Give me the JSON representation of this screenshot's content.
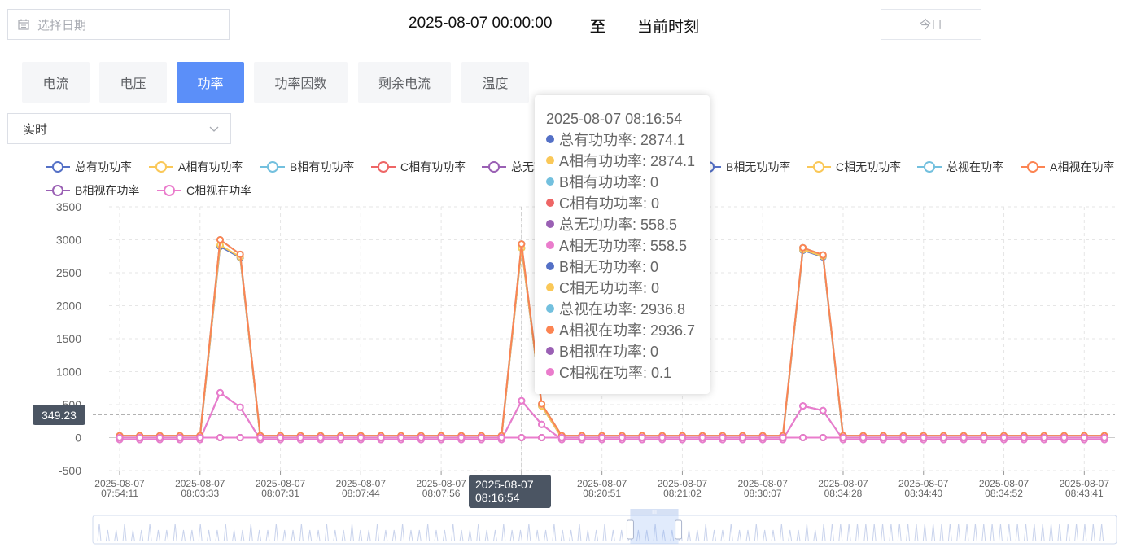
{
  "date_picker": {
    "placeholder": "选择日期"
  },
  "range": {
    "start": "2025-08-07 00:00:00",
    "separator": "至",
    "end": "当前时刻"
  },
  "today_button": "今日",
  "tabs": [
    {
      "label": "电流"
    },
    {
      "label": "电压"
    },
    {
      "label": "功率"
    },
    {
      "label": "功率因数"
    },
    {
      "label": "剩余电流"
    },
    {
      "label": "温度"
    }
  ],
  "active_tab": 2,
  "mode_select": {
    "value": "实时"
  },
  "colors": {
    "total_active": "#5470c6",
    "a_active": "#fac858",
    "b_active": "#73c0de",
    "c_active": "#ee6666",
    "total_reactive": "#9a60b4",
    "a_reactive": "#ea7ccc",
    "b_reactive": "#5470c6",
    "c_reactive": "#fac858",
    "total_apparent": "#73c0de",
    "a_apparent": "#fc8452",
    "b_apparent": "#9a60b4",
    "c_apparent": "#ea7ccc",
    "accent": "#5b8ff9"
  },
  "chart_data": {
    "type": "line",
    "ylim": [
      -500,
      3500
    ],
    "yticks": [
      3500,
      3000,
      2500,
      2000,
      1500,
      1000,
      500,
      0,
      -500
    ],
    "x_tick_labels": [
      {
        "date": "2025-08-07",
        "time": "07:54:11",
        "index": 0
      },
      {
        "date": "2025-08-07",
        "time": "08:03:33",
        "index": 4
      },
      {
        "date": "2025-08-07",
        "time": "08:07:31",
        "index": 8
      },
      {
        "date": "2025-08-07",
        "time": "08:07:44",
        "index": 12
      },
      {
        "date": "2025-08-07",
        "time": "08:07:56",
        "index": 16
      },
      {
        "date": "2025-08-07",
        "time": "08:16:54",
        "index": 20
      },
      {
        "date": "2025-08-07",
        "time": "08:20:51",
        "index": 24
      },
      {
        "date": "2025-08-07",
        "time": "08:21:02",
        "index": 28
      },
      {
        "date": "2025-08-07",
        "time": "08:30:07",
        "index": 32
      },
      {
        "date": "2025-08-07",
        "time": "08:34:28",
        "index": 36
      },
      {
        "date": "2025-08-07",
        "time": "08:34:40",
        "index": 40
      },
      {
        "date": "2025-08-07",
        "time": "08:34:52",
        "index": 44
      },
      {
        "date": "2025-08-07",
        "time": "08:43:41",
        "index": 48
      }
    ],
    "point_count": 50,
    "series": [
      {
        "name": "总有功功率",
        "color": "#5470c6",
        "values": [
          0,
          0,
          0,
          0,
          0,
          2900,
          2730,
          0,
          0,
          0,
          0,
          0,
          0,
          0,
          0,
          0,
          0,
          0,
          0,
          0,
          2874,
          480,
          0,
          0,
          0,
          0,
          0,
          0,
          0,
          0,
          0,
          0,
          0,
          0,
          2840,
          2740,
          0,
          0,
          0,
          0,
          0,
          0,
          0,
          0,
          0,
          0,
          0,
          0,
          0,
          0
        ]
      },
      {
        "name": "A相有功功率",
        "color": "#fac858",
        "values": [
          0,
          0,
          0,
          0,
          0,
          2920,
          2740,
          0,
          0,
          0,
          0,
          0,
          0,
          0,
          0,
          0,
          0,
          0,
          0,
          0,
          2874,
          480,
          0,
          0,
          0,
          0,
          0,
          0,
          0,
          0,
          0,
          0,
          0,
          0,
          2850,
          2750,
          0,
          0,
          0,
          0,
          0,
          0,
          0,
          0,
          0,
          0,
          0,
          0,
          0,
          0
        ]
      },
      {
        "name": "B相有功功率",
        "color": "#73c0de",
        "values": [
          0,
          0,
          0,
          0,
          0,
          0,
          0,
          0,
          0,
          0,
          0,
          0,
          0,
          0,
          0,
          0,
          0,
          0,
          0,
          0,
          0,
          0,
          0,
          0,
          0,
          0,
          0,
          0,
          0,
          0,
          0,
          0,
          0,
          0,
          0,
          0,
          0,
          0,
          0,
          0,
          0,
          0,
          0,
          0,
          0,
          0,
          0,
          0,
          0,
          0
        ]
      },
      {
        "name": "C相有功功率",
        "color": "#ee6666",
        "values": [
          0,
          0,
          0,
          0,
          0,
          0,
          0,
          0,
          0,
          0,
          0,
          0,
          0,
          0,
          0,
          0,
          0,
          0,
          0,
          0,
          0,
          0,
          0,
          0,
          0,
          0,
          0,
          0,
          0,
          0,
          0,
          0,
          0,
          0,
          0,
          0,
          0,
          0,
          0,
          0,
          0,
          0,
          0,
          0,
          0,
          0,
          0,
          0,
          0,
          0
        ]
      },
      {
        "name": "总无功功率",
        "color": "#9a60b4",
        "values": [
          -30,
          -30,
          -30,
          -30,
          -30,
          680,
          460,
          -30,
          -30,
          -30,
          -30,
          -30,
          -30,
          -30,
          -30,
          -30,
          -30,
          -30,
          -30,
          -30,
          558.5,
          200,
          -30,
          -30,
          -30,
          -30,
          -30,
          -30,
          -30,
          -30,
          -30,
          -30,
          -30,
          -30,
          480,
          410,
          -30,
          -30,
          -30,
          -30,
          -30,
          -30,
          -30,
          -30,
          -30,
          -30,
          -30,
          -30,
          -30,
          -30
        ]
      },
      {
        "name": "A相无功功率",
        "color": "#ea7ccc",
        "values": [
          -30,
          -30,
          -30,
          -30,
          -30,
          680,
          460,
          -30,
          -30,
          -30,
          -30,
          -30,
          -30,
          -30,
          -30,
          -30,
          -30,
          -30,
          -30,
          -30,
          558.5,
          200,
          -30,
          -30,
          -30,
          -30,
          -30,
          -30,
          -30,
          -30,
          -30,
          -30,
          -30,
          -30,
          480,
          410,
          -30,
          -30,
          -30,
          -30,
          -30,
          -30,
          -30,
          -30,
          -30,
          -30,
          -30,
          -30,
          -30,
          -30
        ]
      },
      {
        "name": "B相无功功率",
        "color": "#5470c6",
        "values": [
          0,
          0,
          0,
          0,
          0,
          0,
          0,
          0,
          0,
          0,
          0,
          0,
          0,
          0,
          0,
          0,
          0,
          0,
          0,
          0,
          0,
          0,
          0,
          0,
          0,
          0,
          0,
          0,
          0,
          0,
          0,
          0,
          0,
          0,
          0,
          0,
          0,
          0,
          0,
          0,
          0,
          0,
          0,
          0,
          0,
          0,
          0,
          0,
          0,
          0
        ]
      },
      {
        "name": "C相无功功率",
        "color": "#fac858",
        "values": [
          0,
          0,
          0,
          0,
          0,
          0,
          0,
          0,
          0,
          0,
          0,
          0,
          0,
          0,
          0,
          0,
          0,
          0,
          0,
          0,
          0,
          0,
          0,
          0,
          0,
          0,
          0,
          0,
          0,
          0,
          0,
          0,
          0,
          0,
          0,
          0,
          0,
          0,
          0,
          0,
          0,
          0,
          0,
          0,
          0,
          0,
          0,
          0,
          0,
          0
        ]
      },
      {
        "name": "总视在功率",
        "color": "#73c0de",
        "values": [
          30,
          30,
          30,
          30,
          30,
          3000,
          2780,
          30,
          30,
          30,
          30,
          30,
          30,
          30,
          30,
          30,
          30,
          30,
          30,
          30,
          2936.8,
          510,
          30,
          30,
          30,
          30,
          30,
          30,
          30,
          30,
          30,
          30,
          30,
          30,
          2880,
          2770,
          30,
          30,
          30,
          30,
          30,
          30,
          30,
          30,
          30,
          30,
          30,
          30,
          30,
          30
        ]
      },
      {
        "name": "A相视在功率",
        "color": "#fc8452",
        "values": [
          30,
          30,
          30,
          30,
          30,
          3000,
          2780,
          30,
          30,
          30,
          30,
          30,
          30,
          30,
          30,
          30,
          30,
          30,
          30,
          30,
          2936.7,
          510,
          30,
          30,
          30,
          30,
          30,
          30,
          30,
          30,
          30,
          30,
          30,
          30,
          2880,
          2770,
          30,
          30,
          30,
          30,
          30,
          30,
          30,
          30,
          30,
          30,
          30,
          30,
          30,
          30
        ]
      },
      {
        "name": "B相视在功率",
        "color": "#9a60b4",
        "values": [
          0,
          0,
          0,
          0,
          0,
          0,
          0,
          0,
          0,
          0,
          0,
          0,
          0,
          0,
          0,
          0,
          0,
          0,
          0,
          0,
          0,
          0,
          0,
          0,
          0,
          0,
          0,
          0,
          0,
          0,
          0,
          0,
          0,
          0,
          0,
          0,
          0,
          0,
          0,
          0,
          0,
          0,
          0,
          0,
          0,
          0,
          0,
          0,
          0,
          0
        ]
      },
      {
        "name": "C相视在功率",
        "color": "#ea7ccc",
        "values": [
          0,
          0,
          0,
          0,
          0,
          0,
          0,
          0,
          0,
          0,
          0,
          0,
          0,
          0,
          0,
          0,
          0,
          0,
          0,
          0,
          0,
          0,
          0,
          0,
          0,
          0,
          0,
          0,
          0,
          0,
          0,
          0,
          0,
          0,
          0,
          0,
          0,
          0,
          0,
          0,
          0,
          0,
          0,
          0,
          0,
          0,
          0,
          0,
          0,
          0
        ]
      }
    ],
    "axis_pointer": {
      "x_label_date": "2025-08-07",
      "x_label_time": "08:16:54",
      "y_label": "349.23",
      "y_value": 349.23,
      "x_index": 20
    },
    "tooltip": {
      "title": "2025-08-07 08:16:54",
      "rows": [
        {
          "label": "总有功功率: 2874.1",
          "color": "#5470c6"
        },
        {
          "label": "A相有功功率: 2874.1",
          "color": "#fac858"
        },
        {
          "label": "B相有功功率: 0",
          "color": "#73c0de"
        },
        {
          "label": "C相有功功率: 0",
          "color": "#ee6666"
        },
        {
          "label": "总无功功率: 558.5",
          "color": "#9a60b4"
        },
        {
          "label": "A相无功功率: 558.5",
          "color": "#ea7ccc"
        },
        {
          "label": "B相无功功率: 0",
          "color": "#5470c6"
        },
        {
          "label": "C相无功功率: 0",
          "color": "#fac858"
        },
        {
          "label": "总视在功率: 2936.8",
          "color": "#73c0de"
        },
        {
          "label": "A相视在功率: 2936.7",
          "color": "#fc8452"
        },
        {
          "label": "B相视在功率: 0",
          "color": "#9a60b4"
        },
        {
          "label": "C相视在功率: 0.1",
          "color": "#ea7ccc"
        }
      ]
    },
    "zoom_window": {
      "start_fraction": 0.525,
      "end_fraction": 0.572
    },
    "zoom_handle_label": "III"
  }
}
